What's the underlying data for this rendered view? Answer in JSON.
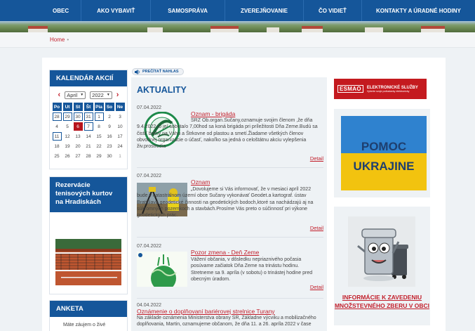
{
  "nav": {
    "items": [
      "OBEC",
      "AKO VYBAVIŤ",
      "SAMOSPRÁVA",
      "ZVEREJŇOVANIE",
      "ČO VIDIEŤ",
      "KONTAKTY A ÚRADNÉ HODINY"
    ]
  },
  "breadcrumb": {
    "home": "Home",
    "separator": "•"
  },
  "calendar": {
    "title": "KALENDÁR AKCIÍ",
    "prev": "‹",
    "next": "›",
    "month": "April",
    "year": "2022",
    "weekdays": [
      "Po",
      "Ut",
      "St",
      "Št",
      "Pia",
      "So",
      "Ne"
    ],
    "days": [
      "28",
      "29",
      "30",
      "31",
      "1",
      "2",
      "3",
      "4",
      "5",
      "6",
      "7",
      "8",
      "9",
      "10",
      "11",
      "12",
      "13",
      "14",
      "15",
      "16",
      "17",
      "18",
      "19",
      "20",
      "21",
      "22",
      "23",
      "24",
      "25",
      "26",
      "27",
      "28",
      "29",
      "30",
      "1"
    ],
    "event_days": [
      0,
      1,
      2,
      3,
      4,
      10,
      14
    ],
    "today_index": 9,
    "other_month": [
      0,
      1,
      2,
      3,
      34
    ]
  },
  "tennis": {
    "title": "Rezervácie tenisových kurtov na Hradiskách"
  },
  "poll": {
    "title": "ANKETA",
    "question": "Máte záujem o živé"
  },
  "speak_button": "PREČÍTAŤ NAHLAS",
  "news": {
    "title": "AKTUALITY",
    "detail_label": "Detail",
    "articles": [
      {
        "date": "07.04.2022",
        "title": "Oznam - brigáda",
        "body": "SRZ Ob.organ.Sučany,oznamuje svojim členom ,že dňa 9.4.2022 to je/ sobota/o 7,00hod sa koná brigáda pri príležitosti Dňa Zeme.Budú sa čistiť brehy na Váhu a Štrkovne od plastou a smetí.Žiadame všetkých členov obvodnej organizácie o účasť, nakoľko sa jedná o celoštátnu akciu vylepšenia živ.prostredia"
      },
      {
        "date": "07.04.2022",
        "title": "Oznam",
        "body": "„Dovolujeme si Vás informovať, že v mesiaci apríl 2022 bude v katastrálnom území obce Sučany vykonávať Geodet.a kartograf. ústav Bratislava geodetické činnosti na geodetických bodoch,ktoré sa nachádzajú aj na súkromných pozemkoch a stavbách.Prosíme Vás preto o súčinnosť pri výkone geodetických prác."
      },
      {
        "date": "07.04.2022",
        "title": "Pozor zmena - Deň Zeme",
        "body": "Vážení občania, v dôsledku nepriaznivého počasia posúvame začiatok Dňa Zeme na trinástu hodinu. Stretneme sa 9. apríla (v sobotu) o trinástej hodine pred obecným úradom."
      },
      {
        "date": "04.04.2022",
        "title": "Oznámenie o doplňovaní bariérovej strelnice Turany",
        "body": "Na základe oznámenia Ministerstva obrany SR, Základne výcviku a mobilizačného doplňovania, Martin, oznamujeme občanom, že dňa 11. a 26. apríla 2022 v čase"
      }
    ]
  },
  "esmao": {
    "logo": "ESMAO",
    "line1": "ELEKTRONICKÉ SLUŽBY",
    "line2": "Vyberte svoje požiadavky elektronicky"
  },
  "ukraine": {
    "line1": "POMOC",
    "line2": "UKRAJINE"
  },
  "zber": {
    "label": "INFORMÁCIE K ZAVEDENIU MNOŽSTEVNÉHO ZBERU V OBCI"
  },
  "colors": {
    "nav": "#15569a",
    "accent": "#c21f2b",
    "panel": "#eef2f5",
    "today": "#b7141d"
  }
}
